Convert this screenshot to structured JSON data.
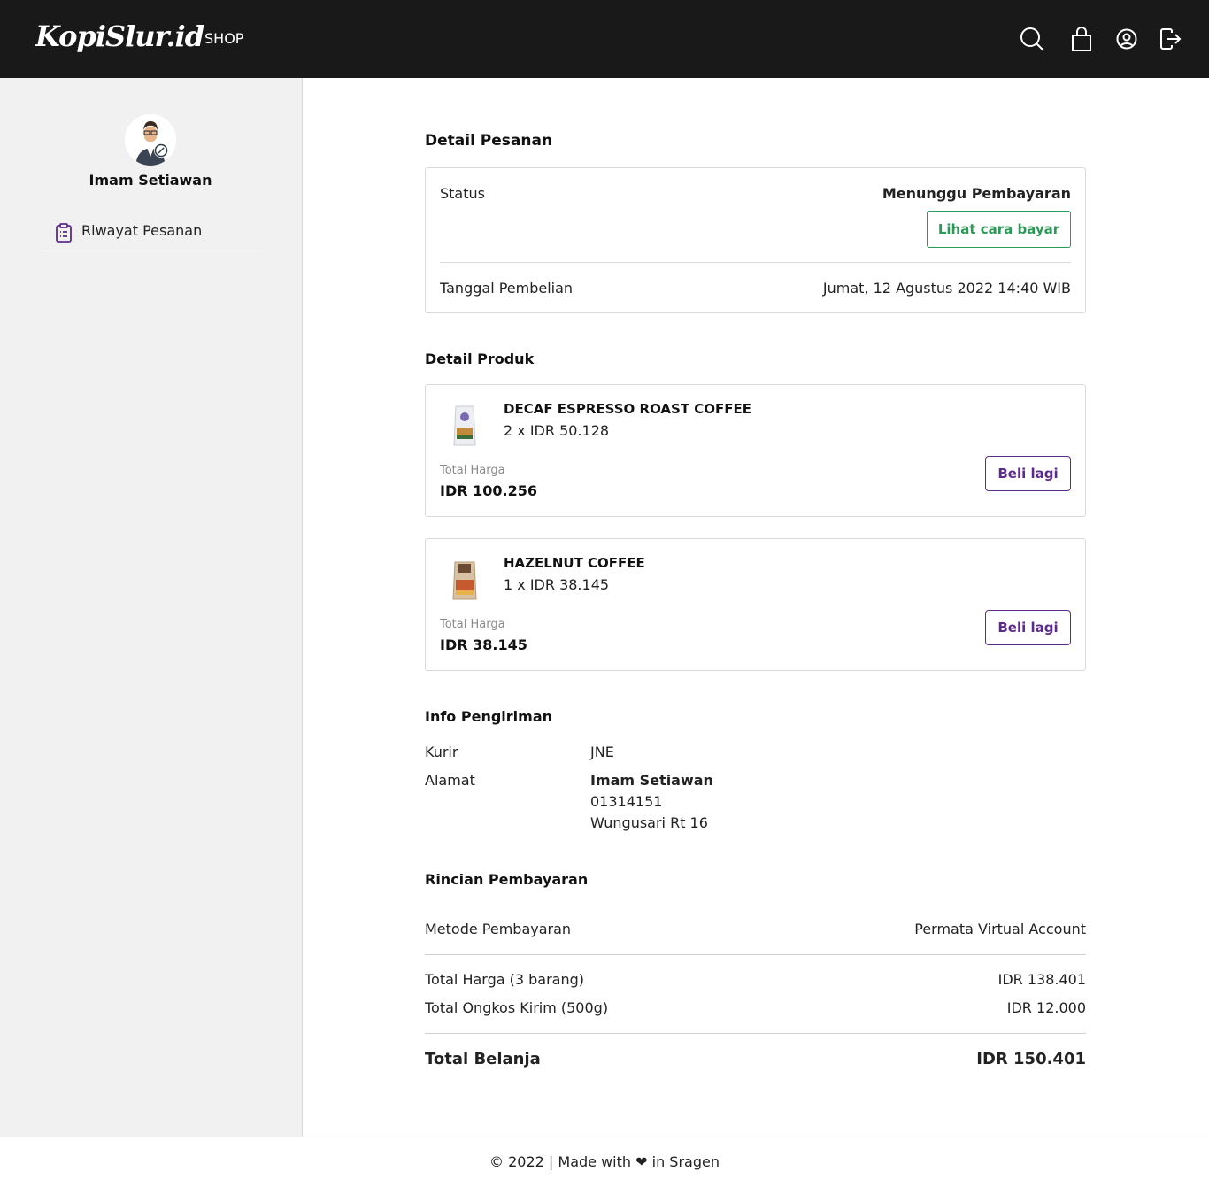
{
  "header": {
    "logo": "KopiSlur.id",
    "nav_shop": "SHOP",
    "icons": [
      "search-icon",
      "bag-icon",
      "account-icon",
      "logout-icon"
    ]
  },
  "sidebar": {
    "profile_name": "Imam Setiawan",
    "items": [
      {
        "label": "Riwayat Pesanan",
        "icon": "clipboard-icon"
      }
    ]
  },
  "order": {
    "title": "Detail Pesanan",
    "status_label": "Status",
    "status_value": "Menunggu Pembayaran",
    "payment_howto_button": "Lihat cara bayar",
    "date_label": "Tanggal Pembelian",
    "date_value": "Jumat, 12 Agustus 2022 14:40 WIB"
  },
  "products": {
    "title": "Detail Produk",
    "total_label": "Total Harga",
    "buy_again_label": "Beli lagi",
    "items": [
      {
        "name": "DECAF ESPRESSO ROAST COFFEE",
        "qty_price": "2 x IDR 50.128",
        "total": "IDR 100.256"
      },
      {
        "name": "HAZELNUT COFFEE",
        "qty_price": "1 x IDR 38.145",
        "total": "IDR 38.145"
      }
    ]
  },
  "shipping": {
    "title": "Info Pengiriman",
    "courier_label": "Kurir",
    "courier_value": "JNE",
    "address_label": "Alamat",
    "recipient": "Imam Setiawan",
    "phone": "01314151",
    "address": "Wungusari Rt 16"
  },
  "payment": {
    "title": "Rincian Pembayaran",
    "method_label": "Metode Pembayaran",
    "method_value": "Permata Virtual Account",
    "items_label": "Total Harga (3 barang)",
    "items_value": "IDR 138.401",
    "shipping_label": "Total Ongkos Kirim (500g)",
    "shipping_value": "IDR 12.000",
    "grand_label": "Total Belanja",
    "grand_value": "IDR 150.401"
  },
  "footer": {
    "text": "© 2022 | Made with ❤ in Sragen"
  },
  "colors": {
    "header_bg": "#191919",
    "accent_green": "#2a9a56",
    "accent_purple": "#5b2b8c",
    "sidebar_bg": "#f1f1f1"
  }
}
